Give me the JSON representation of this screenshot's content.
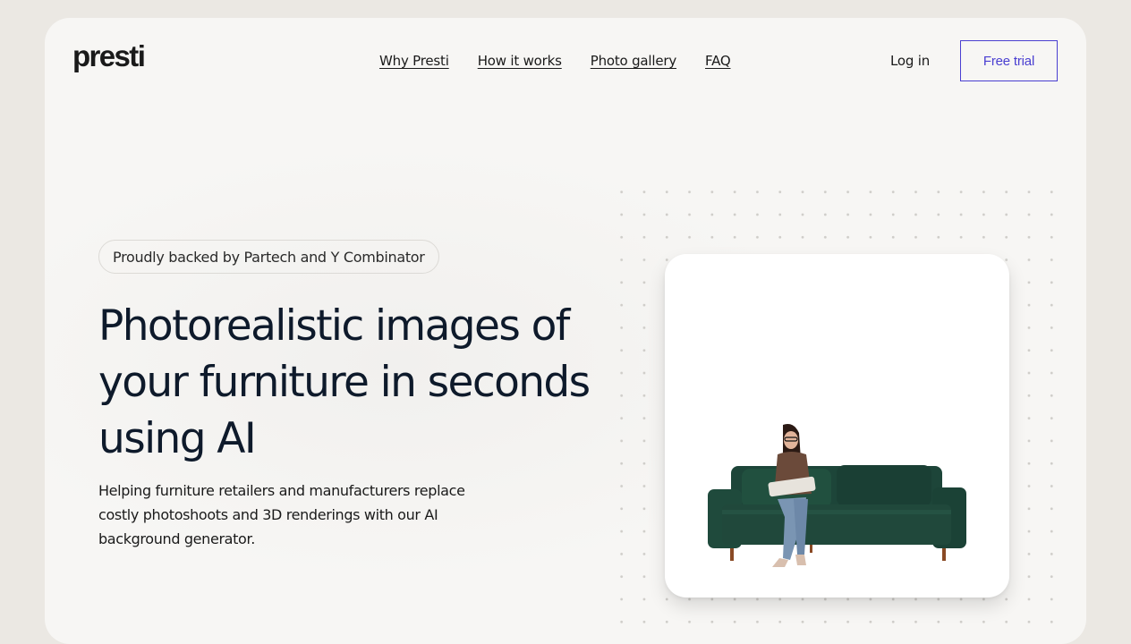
{
  "brand": {
    "logo_text": "presti"
  },
  "nav": {
    "links": [
      {
        "label": "Why Presti"
      },
      {
        "label": "How it works"
      },
      {
        "label": "Photo gallery"
      },
      {
        "label": "FAQ"
      }
    ],
    "login_label": "Log in",
    "cta_label": "Free trial"
  },
  "hero": {
    "badge": "Proudly backed by Partech and Y Combinator",
    "headline": "Photorealistic images of your furniture in seconds using AI",
    "subtext": "Helping furniture retailers and manufacturers replace costly photoshoots and 3D renderings with our AI background generator."
  },
  "colors": {
    "page_bg": "#ebe8e3",
    "frame_bg": "#f7f6f4",
    "accent": "#4a3fd1",
    "headline": "#0e1a2b",
    "sofa": "#1f4a3c"
  },
  "media": {
    "product_icon": "sofa-with-person-image"
  }
}
